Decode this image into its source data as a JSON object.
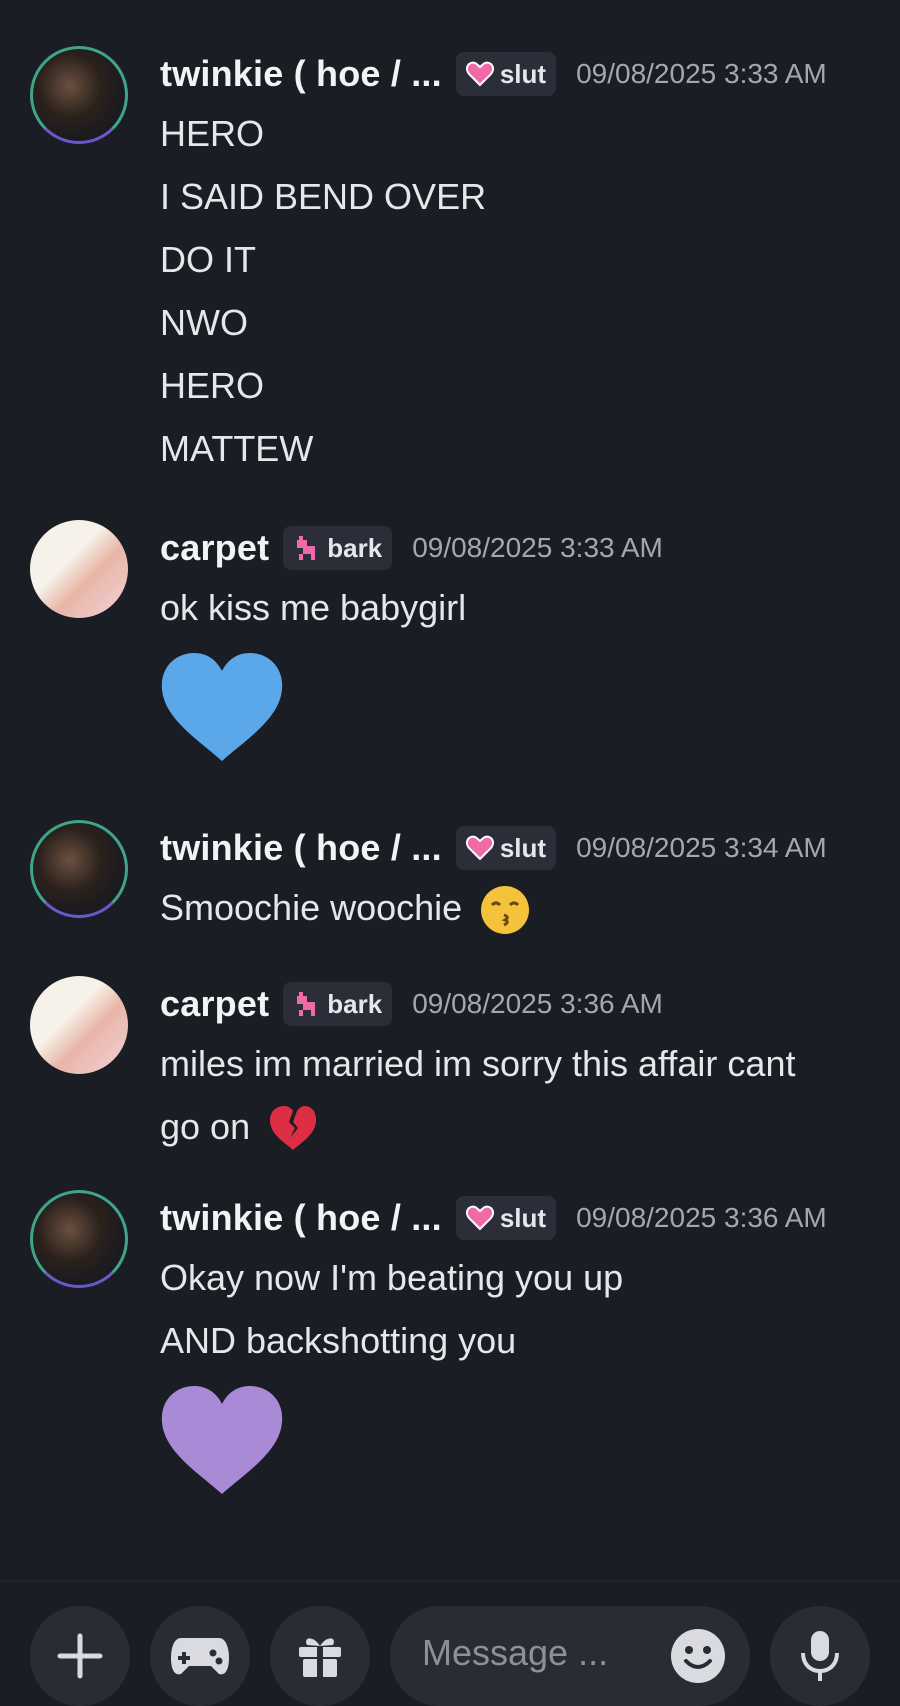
{
  "messages": [
    {
      "author": "twinkie ( hoe / ...",
      "tag": "slut",
      "tag_icon": "pink-heart-icon",
      "time": "09/08/2025 3:33 AM",
      "lines": [
        "HERO",
        "I SAID BEND OVER",
        "DO IT",
        "NWO",
        "HERO",
        "MATTEW"
      ]
    },
    {
      "author": "carpet",
      "tag": "bark",
      "tag_icon": "pink-dog-icon",
      "time": "09/08/2025 3:33 AM",
      "lines": [
        "ok kiss me babygirl"
      ],
      "big_emoji": "blue-heart-icon"
    },
    {
      "author": "twinkie ( hoe / ...",
      "tag": "slut",
      "tag_icon": "pink-heart-icon",
      "time": "09/08/2025 3:34 AM",
      "lines": [
        "Smoochie woochie"
      ],
      "inline_emoji": "kissing-face-icon"
    },
    {
      "author": "carpet",
      "tag": "bark",
      "tag_icon": "pink-dog-icon",
      "time": "09/08/2025 3:36 AM",
      "lines": [
        "miles im married im sorry this affair cant",
        "go on"
      ],
      "inline_emoji": "broken-heart-icon"
    },
    {
      "author": "twinkie ( hoe / ...",
      "tag": "slut",
      "tag_icon": "pink-heart-icon",
      "time": "09/08/2025 3:36 AM",
      "lines": [
        "Okay now I'm beating you up",
        "AND backshotting you"
      ],
      "big_emoji": "purple-heart-icon"
    }
  ],
  "composer": {
    "placeholder": "Message ...",
    "buttons": [
      "plus-icon",
      "gamepad-icon",
      "gift-icon",
      "emoji-icon",
      "microphone-icon"
    ]
  },
  "colors": {
    "background": "#1b1d24",
    "blue_heart": "#5aa7ea",
    "purple_heart": "#a98ad7",
    "tag_pink": "#f06aa9"
  }
}
